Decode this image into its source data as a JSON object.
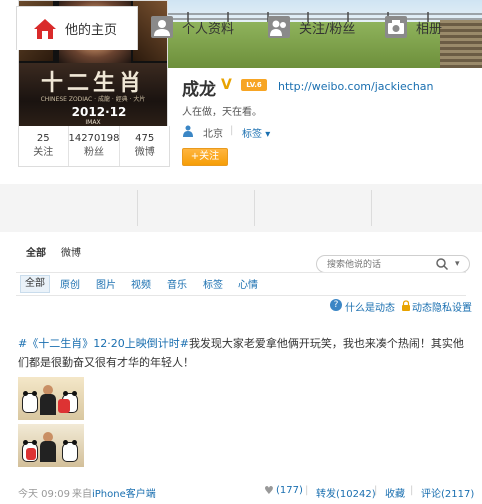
{
  "profile": {
    "name": "成龙",
    "verified_badge": "V",
    "vip_badge": "LV.6",
    "home_url": "http://weibo.com/jackiechan",
    "bio": "人在做，天在看。",
    "location": "北京",
    "tags_label": "标签",
    "follow_button": "+关注",
    "stats": [
      {
        "num": "25",
        "label": "关注"
      },
      {
        "num": "14270198",
        "label": "粉丝"
      },
      {
        "num": "475",
        "label": "微博"
      }
    ],
    "poster": {
      "title": "十二生肖",
      "subtitle": "CHINESE ZODIAC · 成龍 · 經典 · 大片",
      "date": "2012·12",
      "imax": "IMAX"
    }
  },
  "nav": {
    "tabs": [
      {
        "label": "他的主页",
        "icon": "home-icon"
      },
      {
        "label": "个人资料",
        "icon": "profile-icon"
      },
      {
        "label": "关注/粉丝",
        "icon": "follow-icon"
      },
      {
        "label": "相册",
        "icon": "camera-icon"
      }
    ]
  },
  "feed": {
    "subtabs": [
      "全部",
      "微博"
    ],
    "search_placeholder": "搜索他说的话",
    "filters": [
      "全部",
      "原创",
      "图片",
      "视频",
      "音乐",
      "标签",
      "心情"
    ],
    "help_link": "什么是动态",
    "privacy_link": "动态隐私设置"
  },
  "post": {
    "topic": "#《十二生肖》12·20上映倒计时#",
    "text": "我发现大家老爱拿他俩开玩笑，我也来凑个热闹！其实他们都是很勤奋又很有才华的年轻人！",
    "time": "今天 09:09",
    "from_label": "来自",
    "client": "iPhone客户端",
    "like": "(177)",
    "repost": "转发(10242)",
    "favorite": "收藏",
    "comment": "评论(2117)",
    "separator": "|"
  },
  "colors": {
    "link": "#1a6fb0",
    "accent_orange": "#f69e07",
    "badge_gold": "#e8a300"
  }
}
